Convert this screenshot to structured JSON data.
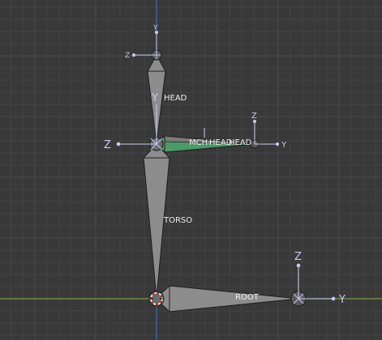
{
  "viewport": {
    "background": "#393939",
    "x_axis_color": "#7c9a45",
    "y_axis_color": "#3b6da8",
    "axis_gizmo_color": "#c8c8f0"
  },
  "bones": {
    "head_label": "HEAD",
    "torso_label": "TORSO",
    "root_label": "ROOT",
    "overlap_label_a": "MCH-",
    "overlap_label_b": "HEAD",
    "overlap_label_c": "HEAD",
    "bone_color": "#8c8c8c",
    "selected_bone_color": "#4b9a6a"
  },
  "gizmos": {
    "head_tip": {
      "y": "Y",
      "z": "Z"
    },
    "neck": {
      "y": "Y",
      "z": "Z"
    },
    "mch_tip": {
      "y": "Y",
      "z": "Z"
    },
    "root_tip": {
      "y": "Y",
      "z": "Z"
    }
  }
}
